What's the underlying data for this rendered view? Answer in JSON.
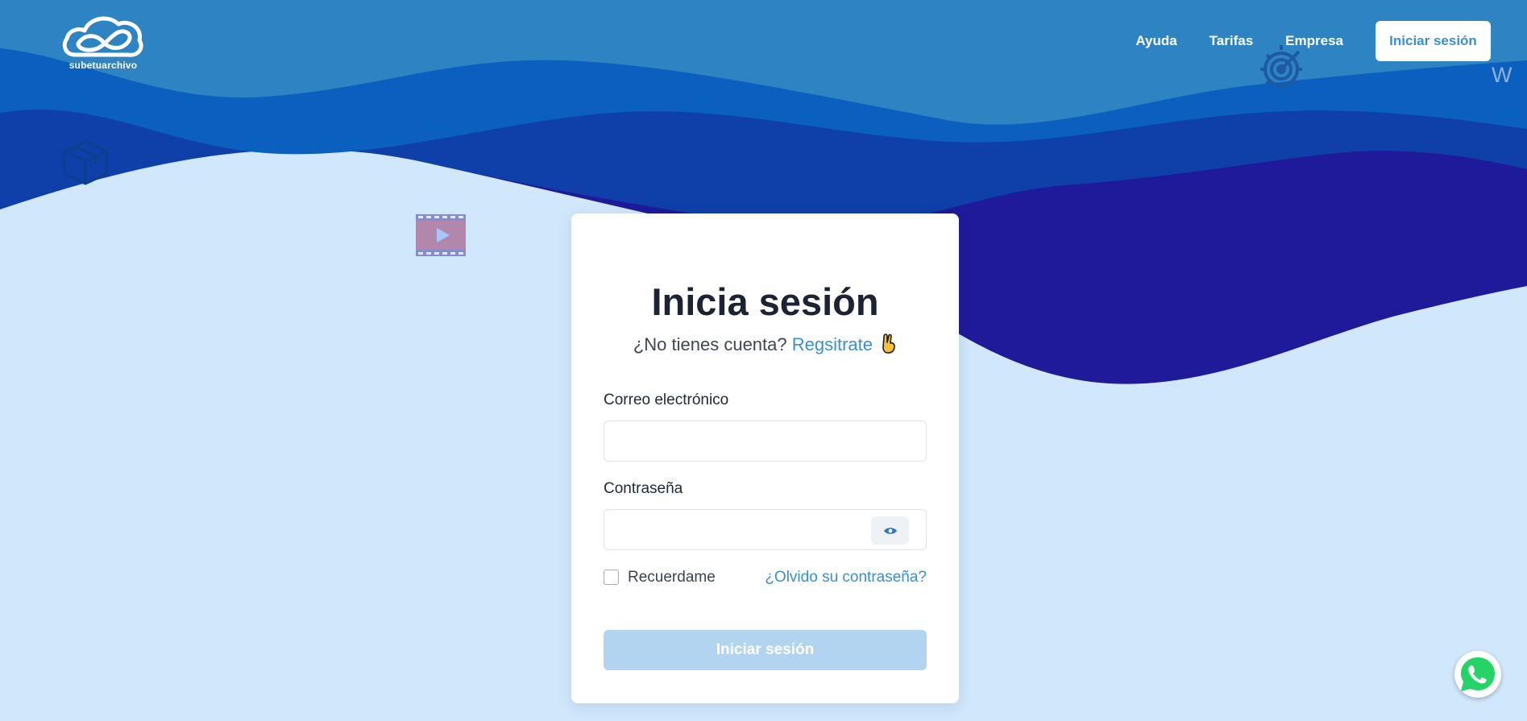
{
  "header": {
    "logo_text": "subetuarchivo",
    "nav_links": [
      "Ayuda",
      "Tarifas",
      "Empresa"
    ],
    "login_button": "Iniciar sesión"
  },
  "login_card": {
    "title": "Inicia sesión",
    "subtitle_prefix": "¿No tienes cuenta?",
    "register_link": "Regsitrate",
    "email_label": "Correo electrónico",
    "email_value": "",
    "password_label": "Contraseña",
    "password_value": "",
    "remember_label": "Recuerdame",
    "remember_checked": false,
    "forgot_link": "¿Olvido su contraseña?",
    "submit_label": "Iniciar sesión"
  },
  "decor": {
    "w_letter": "W"
  },
  "colors": {
    "accent": "#3a8fd3",
    "wave_top": "#2e83c2",
    "wave_mid": "#0b5fbe",
    "wave_deep": "#0f3fa9",
    "wave_darkest": "#1f1a99",
    "background": "#d1e7fb",
    "submit_disabled": "#b3d4f0"
  },
  "icons": {
    "logo": "cloud-infinity-icon",
    "box": "box-icon",
    "video": "video-play-icon",
    "gear": "gear-target-icon",
    "eye": "eye-icon",
    "whatsapp": "whatsapp-icon"
  }
}
